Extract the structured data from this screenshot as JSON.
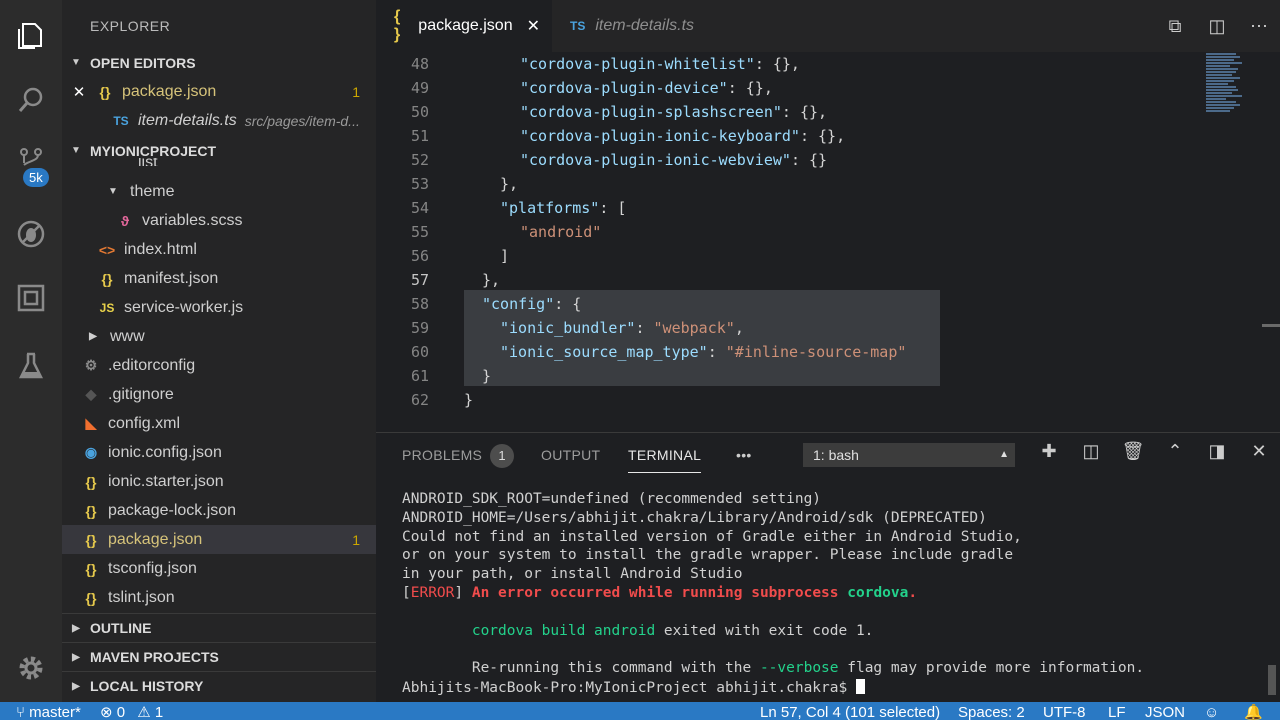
{
  "explorer": {
    "title": "EXPLORER",
    "open_editors": {
      "header": "OPEN EDITORS",
      "items": [
        {
          "name": "package.json",
          "count": "1"
        },
        {
          "name": "item-details.ts",
          "path": "src/pages/item-d..."
        }
      ]
    },
    "project": {
      "header": "MYIONICPROJECT",
      "partial_item": "list",
      "items": [
        {
          "name": "theme"
        },
        {
          "name": "variables.scss"
        },
        {
          "name": "index.html"
        },
        {
          "name": "manifest.json"
        },
        {
          "name": "service-worker.js"
        },
        {
          "name": "www"
        },
        {
          "name": ".editorconfig"
        },
        {
          "name": ".gitignore"
        },
        {
          "name": "config.xml"
        },
        {
          "name": "ionic.config.json"
        },
        {
          "name": "ionic.starter.json"
        },
        {
          "name": "package-lock.json"
        },
        {
          "name": "package.json",
          "count": "1"
        },
        {
          "name": "tsconfig.json"
        },
        {
          "name": "tslint.json"
        }
      ]
    },
    "outline": "OUTLINE",
    "maven": "MAVEN PROJECTS",
    "local_history": "LOCAL HISTORY"
  },
  "activity": {
    "badge": "5k"
  },
  "tabs": [
    {
      "label": "package.json",
      "icon": "{ }"
    },
    {
      "label": "item-details.ts",
      "icon": "TS"
    }
  ],
  "editor": {
    "lines": [
      {
        "n": "48",
        "key": "\"cordova-plugin-whitelist\"",
        "rest": ": {},"
      },
      {
        "n": "49",
        "key": "\"cordova-plugin-device\"",
        "rest": ": {},"
      },
      {
        "n": "50",
        "key": "\"cordova-plugin-splashscreen\"",
        "rest": ": {},"
      },
      {
        "n": "51",
        "key": "\"cordova-plugin-ionic-keyboard\"",
        "rest": ": {},"
      },
      {
        "n": "52",
        "key": "\"cordova-plugin-ionic-webview\"",
        "rest": ": {}"
      },
      {
        "n": "53",
        "text": "},"
      },
      {
        "n": "54",
        "key": "\"platforms\"",
        "rest": ": ["
      },
      {
        "n": "55",
        "str": "\"android\""
      },
      {
        "n": "56",
        "text": "]"
      },
      {
        "n": "57",
        "text": "},"
      },
      {
        "n": "58",
        "key": "\"config\"",
        "rest": ": {"
      },
      {
        "n": "59",
        "key": "\"ionic_bundler\"",
        "rest": ": ",
        "str": "\"webpack\"",
        "tail": ","
      },
      {
        "n": "60",
        "key": "\"ionic_source_map_type\"",
        "rest": ": ",
        "str": "\"#inline-source-map\""
      },
      {
        "n": "61",
        "text": "}"
      },
      {
        "n": "62",
        "text": "}"
      }
    ]
  },
  "panel": {
    "tabs": {
      "problems": "PROBLEMS",
      "problems_count": "1",
      "output": "OUTPUT",
      "terminal": "TERMINAL",
      "more": "•••"
    },
    "shell": "1: bash",
    "terminal": {
      "l1": "ANDROID_SDK_ROOT=undefined (recommended setting)",
      "l2": "ANDROID_HOME=/Users/abhijit.chakra/Library/Android/sdk (DEPRECATED)",
      "l3": "Could not find an installed version of Gradle either in Android Studio,",
      "l4": "or on your system to install the gradle wrapper. Please include gradle",
      "l5": "in your path, or install Android Studio",
      "err_tag": "ERROR",
      "err_msg": "An error occurred while running subprocess",
      "err_cmd": "cordova",
      "err_end": ".",
      "build_cmd": "cordova build android",
      "build_rest": " exited with exit code 1.",
      "rerun_a": "Re-running this command with the ",
      "rerun_flag": "--verbose",
      "rerun_b": " flag may provide more information.",
      "prompt": "Abhijits-MacBook-Pro:MyIonicProject abhijit.chakra$ "
    }
  },
  "status": {
    "branch": "master*",
    "errors": "0",
    "warnings": "1",
    "position": "Ln 57, Col 4 (101 selected)",
    "spaces": "Spaces: 2",
    "encoding": "UTF-8",
    "eol": "LF",
    "language": "JSON"
  }
}
